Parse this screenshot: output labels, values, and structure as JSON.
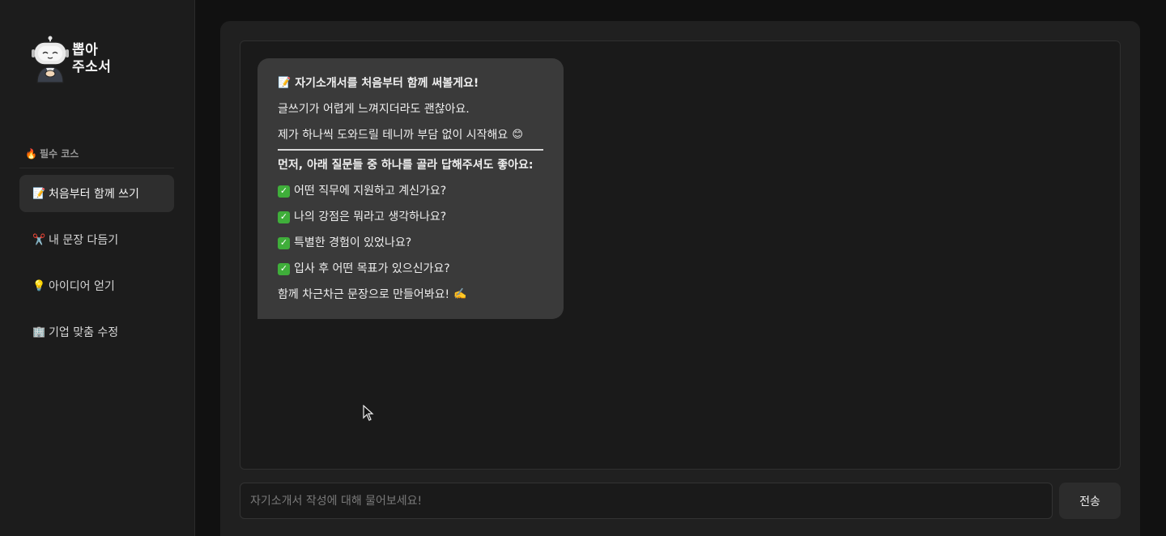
{
  "brand": {
    "line1": "뽑아",
    "line2": "주소서"
  },
  "sidebar": {
    "section_icon": "fire-icon",
    "section_label": "필수 코스",
    "items": [
      {
        "icon": "memo-icon",
        "label": "처음부터 함께 쓰기",
        "active": true
      },
      {
        "icon": "scissors-icon",
        "label": "내 문장 다듬기",
        "active": false
      },
      {
        "icon": "lightbulb-icon",
        "label": "아이디어 얻기",
        "active": false
      },
      {
        "icon": "office-building-icon",
        "label": "기업 맞춤 수정",
        "active": false
      }
    ]
  },
  "chat": {
    "message": {
      "title": "자기소개서를 처음부터 함께 써볼게요!",
      "line1": "글쓰기가 어렵게 느껴지더라도 괜찮아요.",
      "line2": "제가 하나씩 도와드릴 테니까 부담 없이 시작해요",
      "prompt": "먼저, 아래 질문들 중 하나를 골라 답해주셔도 좋아요:",
      "questions": [
        "어떤 직무에 지원하고 계신가요?",
        "나의 강점은 뭐라고 생각하나요?",
        "특별한 경험이 있었나요?",
        "입사 후 어떤 목표가 있으신가요?"
      ],
      "closing": "함께 차근차근 문장으로 만들어봐요!"
    }
  },
  "input": {
    "placeholder": "자기소개서 작성에 대해 물어보세요!",
    "value": "",
    "send_label": "전송"
  },
  "colors": {
    "check": "#3fae3a",
    "bubble": "#3a3a3a",
    "active_nav": "#2e2e2e"
  }
}
